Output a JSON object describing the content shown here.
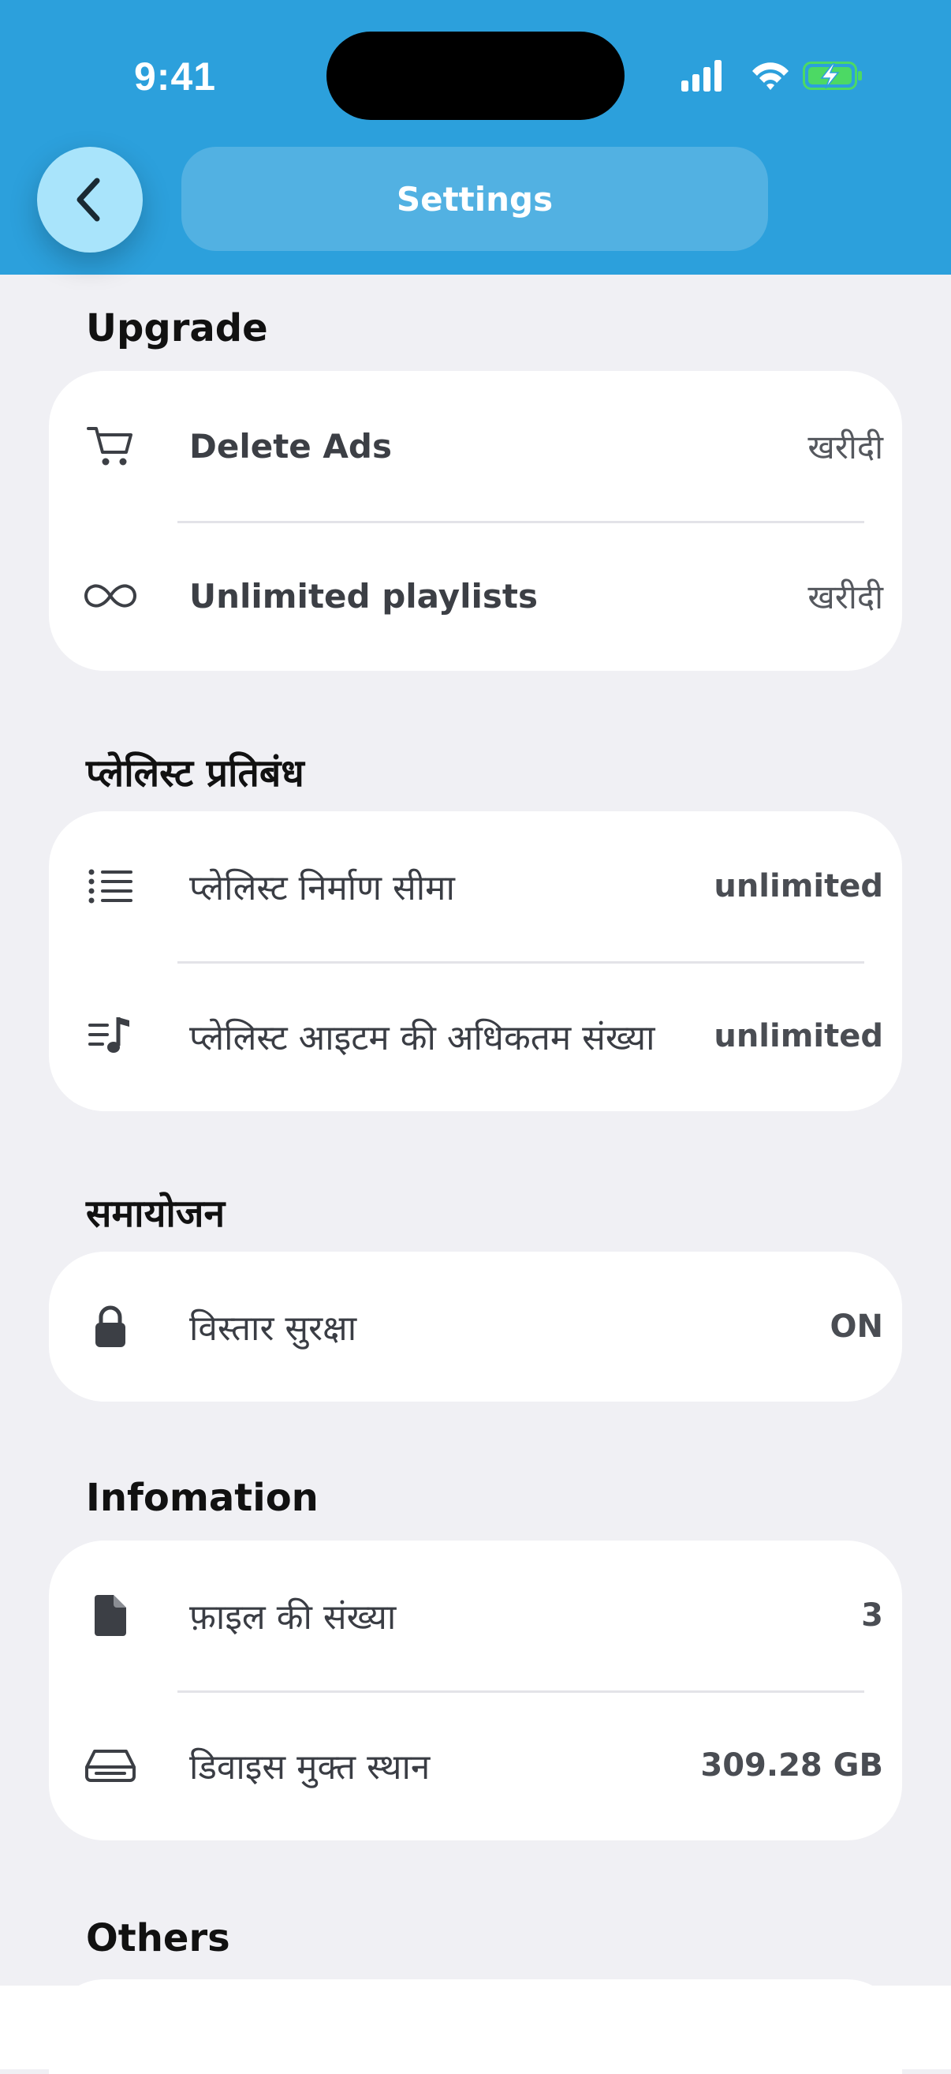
{
  "status_bar": {
    "time": "9:41",
    "icons": [
      "cellular-signal-icon",
      "wifi-icon",
      "battery-charging-icon"
    ],
    "battery_color": "#4cd964"
  },
  "header": {
    "title": "Settings",
    "back_icon": "chevron-left-icon",
    "background_color": "#2ca0dc"
  },
  "sections": {
    "upgrade": {
      "title": "Upgrade",
      "items": [
        {
          "icon": "cart-icon",
          "label": "Delete Ads",
          "value": "खरीदी"
        },
        {
          "icon": "infinity-icon",
          "label": "Unlimited playlists",
          "value": "खरीदी"
        }
      ]
    },
    "playlist_limits": {
      "title": "प्लेलिस्ट प्रतिबंध",
      "items": [
        {
          "icon": "list-icon",
          "label": "प्लेलिस्ट निर्माण सीमा",
          "value": "unlimited"
        },
        {
          "icon": "music-list-icon",
          "label": "प्लेलिस्ट आइटम की अधिकतम संख्या",
          "value": "unlimited"
        }
      ]
    },
    "adjustment": {
      "title": "समायोजन",
      "items": [
        {
          "icon": "lock-icon",
          "label": "विस्तार सुरक्षा",
          "value": "ON"
        }
      ]
    },
    "information": {
      "title": "Infomation",
      "items": [
        {
          "icon": "file-icon",
          "label": "फ़ाइल की संख्या",
          "value": "3"
        },
        {
          "icon": "drive-icon",
          "label": "डिवाइस मुक्त स्थान",
          "value": "309.28 GB"
        }
      ]
    },
    "others": {
      "title": "Others"
    }
  }
}
